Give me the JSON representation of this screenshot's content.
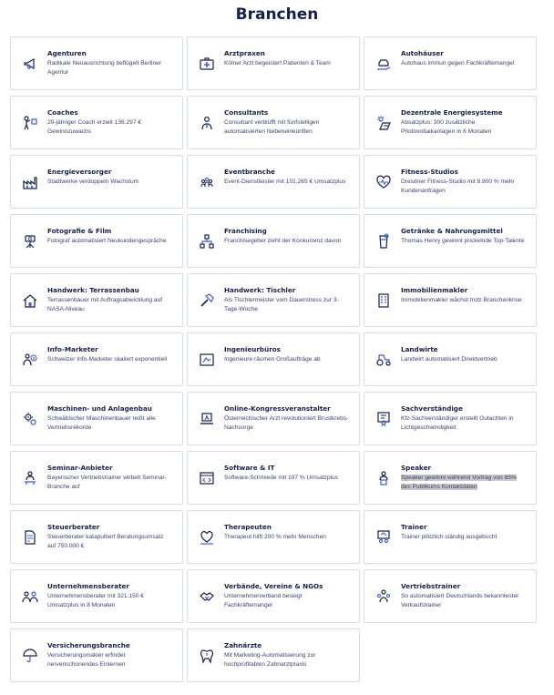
{
  "page": {
    "title": "Branchen"
  },
  "colors": {
    "icon_accent": "#3c5bd9",
    "border": "#d6dbf2",
    "text_dark": "#16204a"
  },
  "items": [
    {
      "name": "Agenturen",
      "desc": "Radikale Neuausrichtung beflügelt Berliner Agentur",
      "icon": "megaphone-icon"
    },
    {
      "name": "Arztpraxen",
      "desc": "Kölner Arzt begeistert Patienten & Team",
      "icon": "medical-kit-icon"
    },
    {
      "name": "Autohäuser",
      "desc": "Autohaus immun gegen Fachkräftemangel",
      "icon": "car-hand-icon"
    },
    {
      "name": "Coaches",
      "desc": "20-jähriger Coach erzielt 136.297 € Gewinnzuwachs",
      "icon": "coach-icon"
    },
    {
      "name": "Consultants",
      "desc": "Consultant verblüfft mit fünfstelligen automatisierten Nebeneinkünften",
      "icon": "consultant-icon"
    },
    {
      "name": "Dezentrale Energiesysteme",
      "desc": "Absatzplus: 300 zusätzliche Photovoltaikanlagen in 6 Monaten",
      "icon": "solar-icon"
    },
    {
      "name": "Energieversorger",
      "desc": "Stadtwerke verdoppeln Wachstum",
      "icon": "factory-icon"
    },
    {
      "name": "Eventbranche",
      "desc": "Event-Dienstleister mit 101.265 € Umsatzplus",
      "icon": "event-crowd-icon"
    },
    {
      "name": "Fitness-Studios",
      "desc": "Dresdner Fitness-Studio mit 8.900 % mehr Kundenanfragen",
      "icon": "heart-pulse-icon"
    },
    {
      "name": "Fotografie & Film",
      "desc": "Fotograf automatisiert Neukundengespräche",
      "icon": "camera-tripod-icon"
    },
    {
      "name": "Franchising",
      "desc": "Franchisegeber zieht der Konkurrenz davon",
      "icon": "network-icon"
    },
    {
      "name": "Getränke & Nahrungsmittel",
      "desc": "Thomas Henry gewinnt prickelnde Top-Talente",
      "icon": "drink-icon"
    },
    {
      "name": "Handwerk: Terrassenbau",
      "desc": "Terrassenbauer mit Auftragsabwicklung auf NASA-Niveau",
      "icon": "house-icon"
    },
    {
      "name": "Handwerk: Tischler",
      "desc": "Als Tischlermeister vom Dauerstress zur 3-Tage-Woche",
      "icon": "hammer-icon"
    },
    {
      "name": "Immobilienmakler",
      "desc": "Immobilienmakler wächst trotz Branchenkrise",
      "icon": "building-icon"
    },
    {
      "name": "Info-Marketer",
      "desc": "Schweizer Info-Marketer skaliert exponentiell",
      "icon": "info-person-icon"
    },
    {
      "name": "Ingenieurbüros",
      "desc": "Ingenieure räumen Großaufträge ab",
      "icon": "blueprint-icon"
    },
    {
      "name": "Landwirte",
      "desc": "Landwirt automatisiert Direktvertrieb",
      "icon": "tractor-icon"
    },
    {
      "name": "Maschinen- und Anlagenbau",
      "desc": "Schwäbischer Maschinenbauer reißt alle Vertriebsrekorde",
      "icon": "gears-icon"
    },
    {
      "name": "Online-Kongressveranstalter",
      "desc": "Österreichischer Arzt revolutioniert Brustkrebs-Nachsorge",
      "icon": "laptop-icon"
    },
    {
      "name": "Sachverständige",
      "desc": "Kfz-Sachverständiger erstellt Gutachten in Lichtgeschwindigkeit",
      "icon": "certificate-icon"
    },
    {
      "name": "Seminar-Anbieter",
      "desc": "Bayerischer Vertriebstrainer wirbelt Seminar-Branche auf",
      "icon": "presenter-icon"
    },
    {
      "name": "Software & IT",
      "desc": "Software-Schmiede mit 107 % Umsatzplus",
      "icon": "code-window-icon"
    },
    {
      "name": "Speaker",
      "desc": "Speaker gewinnt während Vortrag von 65% des Publikums Kontaktdaten",
      "icon": "speaker-icon",
      "highlighted": true
    },
    {
      "name": "Steuerberater",
      "desc": "Steuerberater katapultiert Beratungsumsatz auf 750.000 €",
      "icon": "tax-document-icon"
    },
    {
      "name": "Therapeuten",
      "desc": "Therapeut hilft 200 % mehr Menschen",
      "icon": "therapy-heart-icon"
    },
    {
      "name": "Trainer",
      "desc": "Trainer plötzlich ständig ausgebucht",
      "icon": "trainer-board-icon"
    },
    {
      "name": "Unternehmensberater",
      "desc": "Unternehmensberater mit 321.150 € Umsatzplus in 8 Monaten",
      "icon": "advisor-icon"
    },
    {
      "name": "Verbände, Vereine & NGOs",
      "desc": "Unternehmerverband besiegt Fachkräftemangel",
      "icon": "handshake-icon"
    },
    {
      "name": "Vertriebstrainer",
      "desc": "So automatisiert Deutschlands bekanntester Verkaufstrainer",
      "icon": "sales-team-icon"
    },
    {
      "name": "Versicherungsbranche",
      "desc": "Versicherungsmakler erfindet nervenschonendes Einlernen",
      "icon": "umbrella-icon"
    },
    {
      "name": "Zahnärzte",
      "desc": "Mit Marketing-Automatisierung zur hochprofitablen Zahnarztpraxis",
      "icon": "tooth-icon"
    }
  ]
}
